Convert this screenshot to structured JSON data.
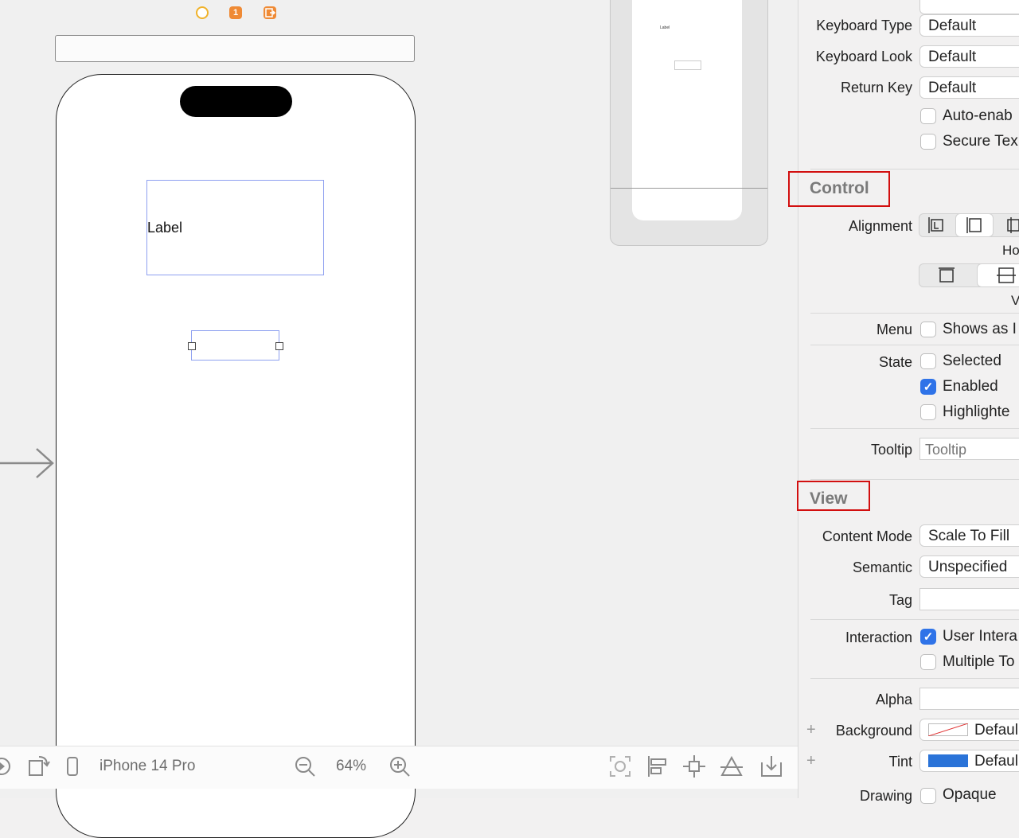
{
  "canvas": {
    "label_text": "Label",
    "thumbnail_text": "Label",
    "scene_icons": [
      "view-controller-icon",
      "first-responder-icon",
      "exit-icon"
    ],
    "scene_icon_colors": [
      "#f0b22a",
      "#ef8a35",
      "#ef8a35"
    ]
  },
  "toolbar": {
    "device": "iPhone 14 Pro",
    "zoom": "64%"
  },
  "inspector": {
    "keyboard_type_label": "Keyboard Type",
    "keyboard_type_value": "Default",
    "keyboard_look_label": "Keyboard Look",
    "keyboard_look_value": "Default",
    "return_key_label": "Return Key",
    "return_key_value": "Default",
    "auto_enable_label": "Auto-enab",
    "secure_text_label": "Secure Tex",
    "control_section": "Control",
    "alignment_label": "Alignment",
    "horizontal_caption": "Ho",
    "vertical_caption": "V",
    "menu_label": "Menu",
    "shows_as_label": "Shows as I",
    "state_label": "State",
    "selected_label": "Selected",
    "enabled_label": "Enabled",
    "highlighted_label": "Highlighte",
    "tooltip_label": "Tooltip",
    "tooltip_placeholder": "Tooltip",
    "view_section": "View",
    "content_mode_label": "Content Mode",
    "content_mode_value": "Scale To Fill",
    "semantic_label": "Semantic",
    "semantic_value": "Unspecified",
    "tag_label": "Tag",
    "interaction_label": "Interaction",
    "user_interaction_label": "User Intera",
    "multiple_touch_label": "Multiple To",
    "alpha_label": "Alpha",
    "background_label": "Background",
    "background_value": "Defaul",
    "tint_label": "Tint",
    "tint_value": "Defaul",
    "tint_color": "#2a73d8",
    "drawing_label": "Drawing",
    "opaque_label": "Opaque",
    "enabled_checked": true,
    "user_interaction_checked": true
  }
}
